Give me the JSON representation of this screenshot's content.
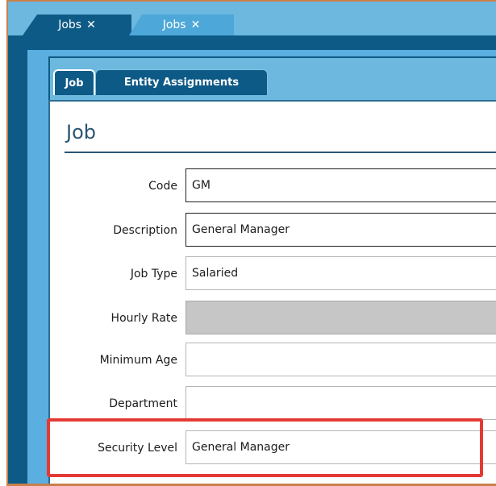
{
  "tabs": [
    {
      "label": "Jobs",
      "close_glyph": "✕"
    },
    {
      "label": "Jobs",
      "close_glyph": "✕"
    }
  ],
  "form_tabs": {
    "job": "Job",
    "entity_assignments": "Entity Assignments"
  },
  "section": {
    "title": "Job"
  },
  "fields": {
    "code": {
      "label": "Code",
      "value": "GM"
    },
    "description": {
      "label": "Description",
      "value": "General Manager"
    },
    "job_type": {
      "label": "Job Type",
      "value": "Salaried"
    },
    "hourly_rate": {
      "label": "Hourly Rate",
      "value": ""
    },
    "minimum_age": {
      "label": "Minimum Age",
      "value": ""
    },
    "department": {
      "label": "Department",
      "value": ""
    },
    "security_level": {
      "label": "Security Level",
      "value": "General Manager"
    }
  },
  "colors": {
    "tab_strip": "#6cb8df",
    "workspace": "#0e5a86",
    "highlight": "#e53935"
  }
}
